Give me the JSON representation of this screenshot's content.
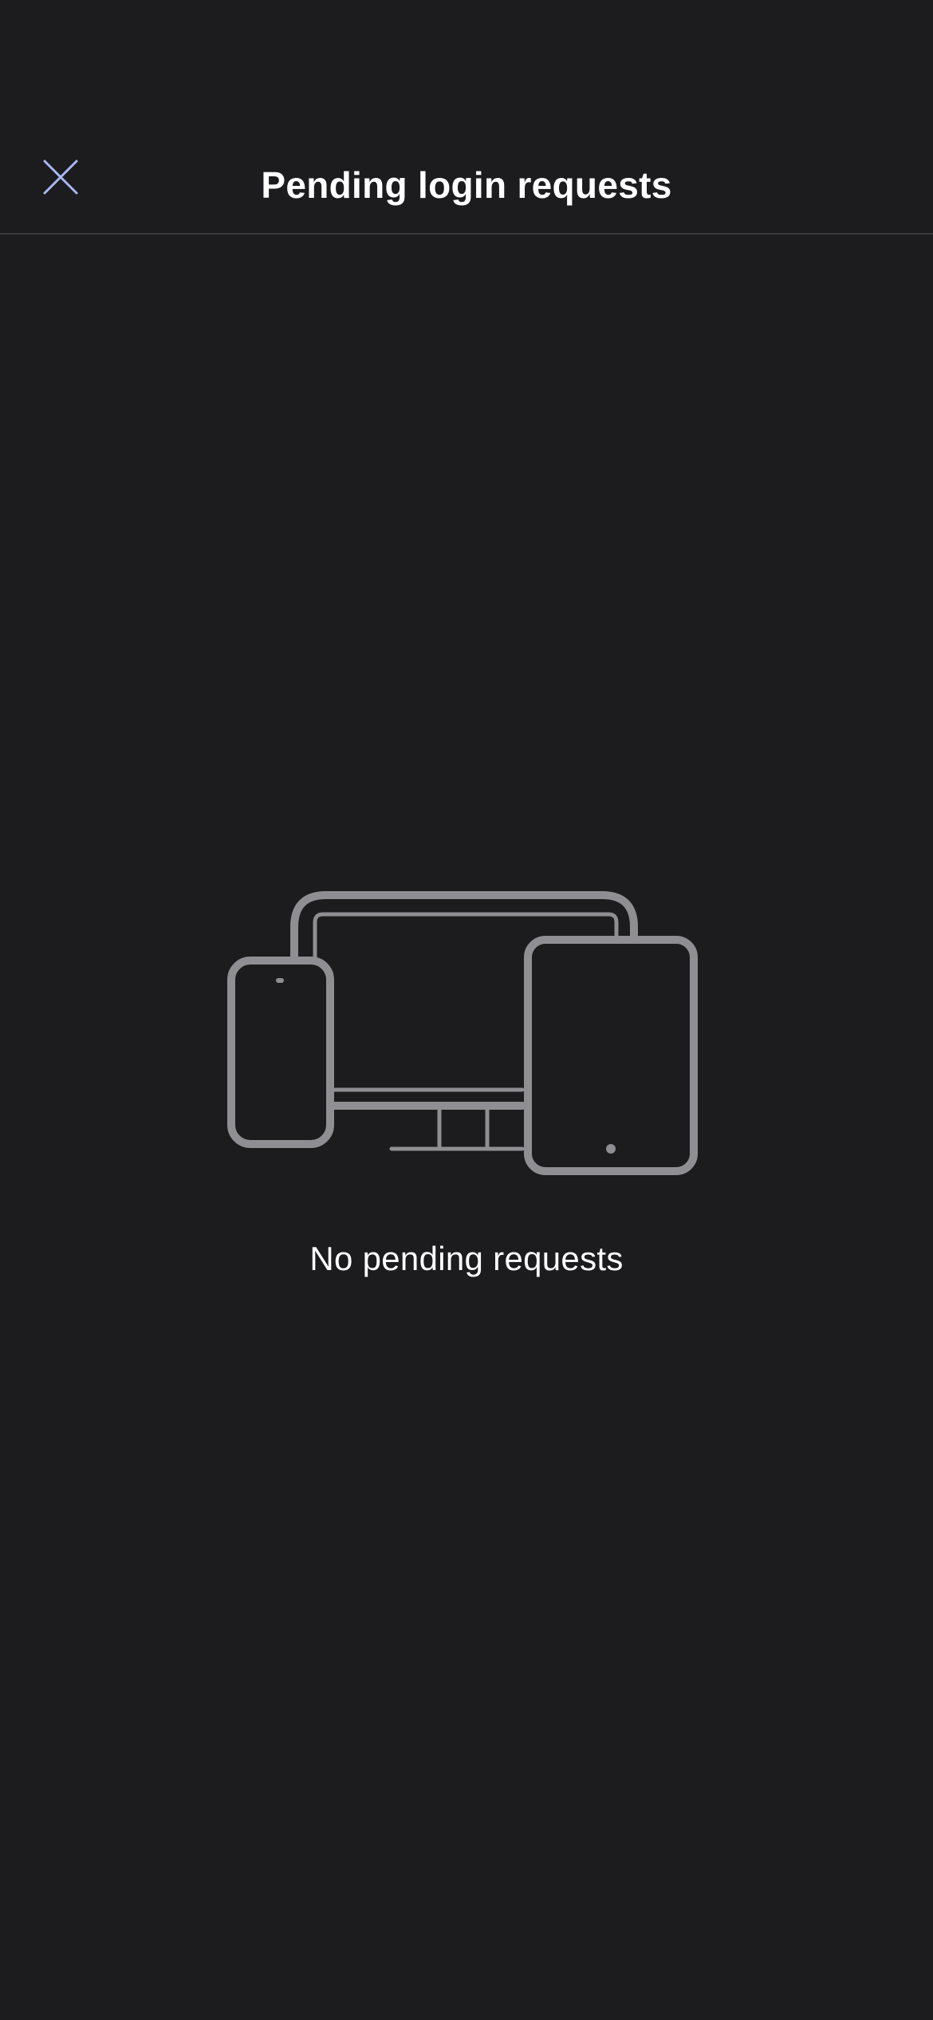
{
  "header": {
    "title": "Pending login requests",
    "close_icon": "close-icon",
    "accent_color": "#a9b8f2"
  },
  "empty_state": {
    "illustration": "devices-icon",
    "message": "No pending requests",
    "illustration_color": "#8e8e93"
  },
  "colors": {
    "background": "#1c1c1e",
    "divider": "#3a3a3c",
    "text": "#ffffff"
  }
}
